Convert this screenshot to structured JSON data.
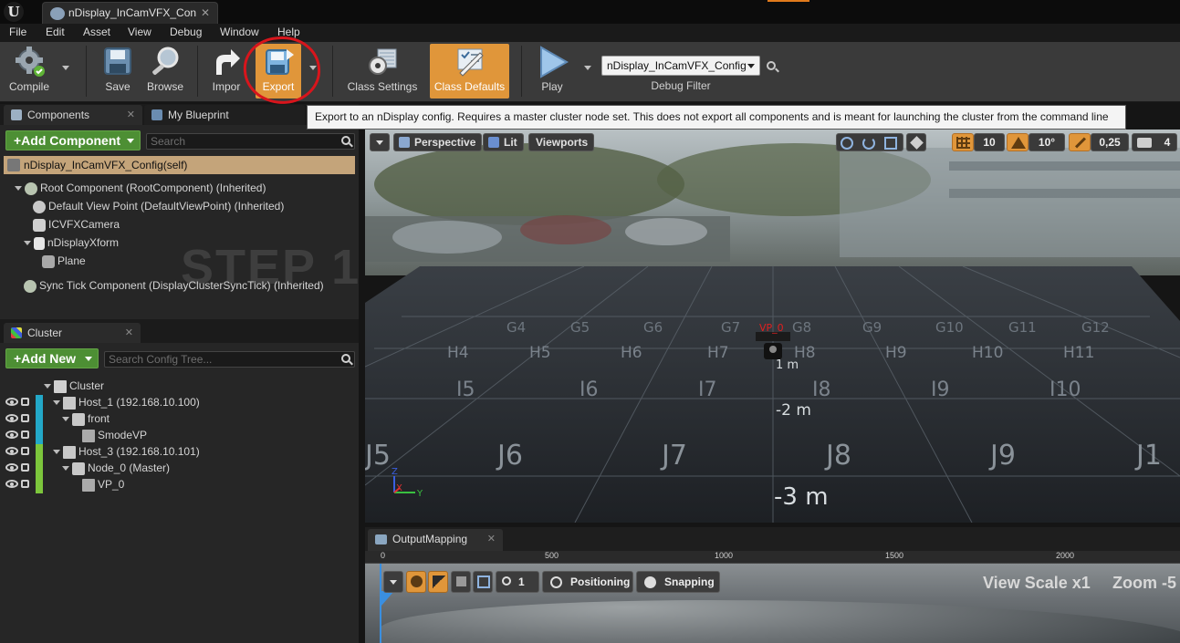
{
  "document_tab": {
    "title": "nDisplay_InCamVFX_Con",
    "close": "✕"
  },
  "menu": [
    "File",
    "Edit",
    "Asset",
    "View",
    "Debug",
    "Window",
    "Help"
  ],
  "toolbar": {
    "compile": "Compile",
    "save": "Save",
    "browse": "Browse",
    "import": "Impor",
    "export": "Export",
    "class_settings": "Class Settings",
    "class_defaults": "Class Defaults",
    "play": "Play",
    "debug_combo": "nDisplay_InCamVFX_Config",
    "debug_filter": "Debug Filter"
  },
  "tooltip": "Export to an nDisplay config. Requires a master cluster node set. This does not export all components and is meant for launching the cluster from the command line",
  "components_panel": {
    "tab_components": "Components",
    "tab_blueprint": "My Blueprint",
    "add_component": "+Add Component",
    "search_placeholder": "Search",
    "self_row": "nDisplay_InCamVFX_Config(self)",
    "tree": [
      "Root Component (RootComponent) (Inherited)",
      "Default View Point (DefaultViewPoint) (Inherited)",
      "ICVFXCamera",
      "nDisplayXform",
      "Plane",
      "Sync Tick Component (DisplayClusterSyncTick) (Inherited)"
    ],
    "watermark": "STEP 1"
  },
  "cluster_panel": {
    "tab": "Cluster",
    "add_new": "+Add New",
    "search_placeholder": "Search Config Tree...",
    "tree": [
      "Cluster",
      "Host_1 (192.168.10.100)",
      "front",
      "SmodeVP",
      "Host_3 (192.168.10.101)",
      "Node_0 (Master)",
      "VP_0"
    ]
  },
  "viewport": {
    "perspective": "Perspective",
    "lit": "Lit",
    "viewports": "Viewports",
    "grid_snap": "10",
    "angle_snap": "10°",
    "scale_snap": "0,25",
    "camera_speed": "4",
    "vp_label": "VP_0",
    "grid_labels_row_g": [
      "G4",
      "G5",
      "G6",
      "G7",
      "G8",
      "G9",
      "G10",
      "G11",
      "G12"
    ],
    "grid_labels_row_h": [
      "H4",
      "H5",
      "H6",
      "H7",
      "H8",
      "H9",
      "H10",
      "H11"
    ],
    "grid_labels_row_i": [
      "I5",
      "I6",
      "I7",
      "I8",
      "I9",
      "I10"
    ],
    "grid_labels_row_j": [
      "J5",
      "J6",
      "J7",
      "J8",
      "J9",
      "J1"
    ],
    "distance_1": "1 m",
    "distance_2": "-2 m",
    "distance_3": "-3 m",
    "axis_x": "X",
    "axis_y": "Y",
    "axis_z": "Z"
  },
  "output_mapping": {
    "tab": "OutputMapping",
    "ruler": [
      "0",
      "500",
      "1000",
      "1500",
      "2000"
    ],
    "zoom_value": "1",
    "positioning": "Positioning",
    "snapping": "Snapping",
    "view_scale": "View Scale x1",
    "zoom": "Zoom -5"
  },
  "colors": {
    "accent_orange": "#e0963a",
    "green_button": "#4d8f34",
    "host1_bar": "#23a8c8",
    "host3_bar": "#7cc63c",
    "annotation_red": "#d8151c"
  }
}
